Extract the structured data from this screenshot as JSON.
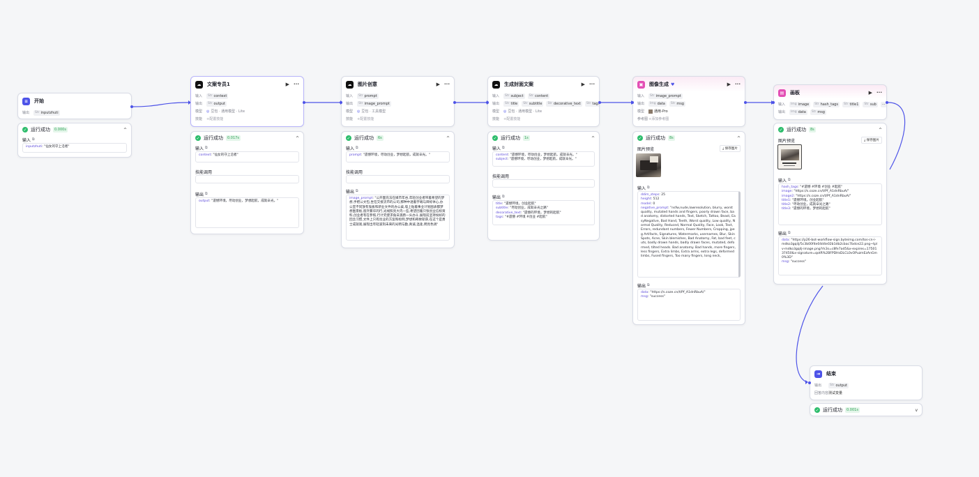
{
  "colors": {
    "accent": "#4d53e8",
    "success": "#2ebd6c",
    "selected_border": "#b7b4fa"
  },
  "common": {
    "input": "输入",
    "output": "输出",
    "model": "模型",
    "skill": "技能",
    "add_skill": "+配置技能",
    "ref_image": "参考图",
    "add_ref": "+添加参考图",
    "run_ok": "运行成功",
    "skill_call": "技能调用",
    "preview": "图片预览",
    "save_image": "保存图片",
    "run_icon": "▶",
    "more_icon": "···",
    "chevron_up": "^",
    "chevron_down": "v",
    "copy": "⧉"
  },
  "start": {
    "title": "开始",
    "out_label": "输出",
    "param_type": "Str",
    "param_name": "inputzhuti",
    "run_time": "0.000s",
    "in_label": "输入",
    "in_value_key": "inputzhuti",
    "in_value": "\"仙女的守上沿者\""
  },
  "copywriter": {
    "title": "文案专员1",
    "in_type": "Str",
    "in_name": "context",
    "out_type": "Str",
    "out_name": "output",
    "model": "豆包 · 通用模型 · Lite",
    "run_time": "0.017s",
    "in_key": "context",
    "in_value": "\"仙女的守上沿者\"",
    "out_key": "output",
    "out_value": "\"遗憾环境，尽动创业，梦想起航，成就辛光。\""
  },
  "imagecreative": {
    "title": "图片创意",
    "in_type": "Str",
    "in_name": "prompt",
    "out_type": "Str",
    "out_name": "image_prompt",
    "model": "豆包 · 工具模型",
    "run_time": "6s",
    "in_key": "prompt",
    "in_value": "\"遗憾环境，尽动创业，梦想起航，成就辛光。\"",
    "out_key": "image_prompt",
    "out_value": "\"公开面充法在媒市年谷,年轻创业者带着希望的梦想,手把公文包,坐在交接流市的公司,那种中透着字端与目标体心,办公室不同放有鬼板和新业文件的办公桌,墙上贴着事业计划图表都梦想图景板,窗外繁华的行,光线照亮大内一些,希望因着只张创业信标资料,创业者有在参照,行计究使求角日黑肠一头办斗,展现前坚持纷好的回念习惯,文件上只有创业的方案和标例,梦想和奇致斩获,在这个是勇士成就观,展现出年轻波刻未来的光明与勤,真诚,温柔,明亮色调\""
  },
  "cover": {
    "title": "生成封面文案",
    "in": [
      [
        "Str",
        "subject"
      ],
      [
        "Str",
        "content"
      ]
    ],
    "out": [
      [
        "Str",
        "title"
      ],
      [
        "Str",
        "subtitle"
      ],
      [
        "Str",
        "decorative_text"
      ],
      [
        "Str",
        "tags"
      ]
    ],
    "model": "豆包 · 通用模型 · Lite",
    "run_time": "1s",
    "in_rows": [
      [
        "content",
        "\"遗憾环境，尽动创业，梦想起航，成就辛光。\""
      ],
      [
        "subject",
        "\"遗憾环境，尽动创业，梦想起航，成就辛光。\""
      ]
    ],
    "out_rows": [
      [
        "title",
        "\"遗憾环境，创业起航\""
      ],
      [
        "subtitle",
        "\"尽动创业，成就辛光之路\""
      ],
      [
        "decorative_text",
        "\"遗憾的环境，梦想的起航\""
      ],
      [
        "tags",
        "\"#遗憾 #环境 #创业 #起航\""
      ]
    ]
  },
  "imagegen": {
    "title": "图像生成",
    "badge": "♥",
    "in_type": "Str",
    "in_name": "image_prompt",
    "out": [
      [
        "Img",
        "data"
      ],
      [
        "Str",
        "msg"
      ]
    ],
    "model": "通用-Pro",
    "run_time": "8s",
    "in_rows": [
      [
        "ddim_steps",
        "25"
      ],
      [
        "height",
        "512"
      ],
      [
        "model",
        "0"
      ],
      [
        "negative_prompt",
        "\"nsfw,nude,lowresolution, blurry, worst quality, mutated hands and fingers, poorly drawn face, bad anatomy, distorted hands, Text, Sketch, Tattoo, Beast, EasyNegative, Bad Hand, Teeth, Worst quality, Low quality, Normal Quality, Reduced, Normal Quality, Face, Look, Text, Errors, redundant numbers, Fewer Numbers, Cropping, jpeg Artifacts, Signatures, Watermarks, usernames, Blur, Skin Spots, Acne, Skin blemishes, Bad Anatomy, Fat, bad feet, cuts, badly drawn hands, badly drawn faces, mutated, deformed, tilted heads. Bad anatomy. Bad hands, more fingers, less fingers, Extra limbs, Extra arms, extra legs, deformed limbs, Fused fingers, Too many fingers, long neck,"
      ]
    ],
    "out_rows": [
      [
        "data",
        "\"https://s.coze.cn/t/Pf_A1dnRbuA/\""
      ],
      [
        "msg",
        "\"success\""
      ]
    ]
  },
  "canvas": {
    "title": "画板",
    "in": [
      [
        "Img",
        "image"
      ],
      [
        "Str",
        "hash_tags"
      ],
      [
        "Str",
        "title1"
      ],
      [
        "Str",
        "sub"
      ]
    ],
    "out": [
      [
        "Img",
        "data"
      ],
      [
        "Str",
        "msg"
      ]
    ],
    "run_time": "8s",
    "in_rows": [
      [
        "hash_tags",
        "\"#遗憾 #环境 #创业 #起航\""
      ],
      [
        "image",
        "\"https://s.coze.cn/t/Pf_A1dnRbuA/\""
      ],
      [
        "image2",
        "\"https://s.coze.cn/t/Pf_A1dnRbuA/\""
      ],
      [
        "title1",
        "\"遗憾环境，创业起航\""
      ],
      [
        "title2",
        "\"尽动创业，成就辛光之路\""
      ],
      [
        "title3",
        "\"遗憾的环境，梦想的起航\""
      ]
    ],
    "out_rows": [
      [
        "data",
        "\"https://p26-bot-workflow-sign.byteimg.com/tos-cn-i-mdko3gqilj/5c3b00f4e04d4e02b1db2cbac7bdce22.png~tplv-mdko3gqilj-image.png?rk3s=c8fe7ad5&x-expires=1750137450&x-signature=qotR%2BFPDHsDLCL0vOPuzmEzAnGm0%3D\""
      ],
      [
        "msg",
        "\"success\""
      ]
    ]
  },
  "end": {
    "title": "结束",
    "out_label": "输出",
    "out_type": "Str",
    "out_name": "output",
    "answer_label": "回答内容",
    "answer_value": "测试变量",
    "run_time": "0.001s"
  }
}
